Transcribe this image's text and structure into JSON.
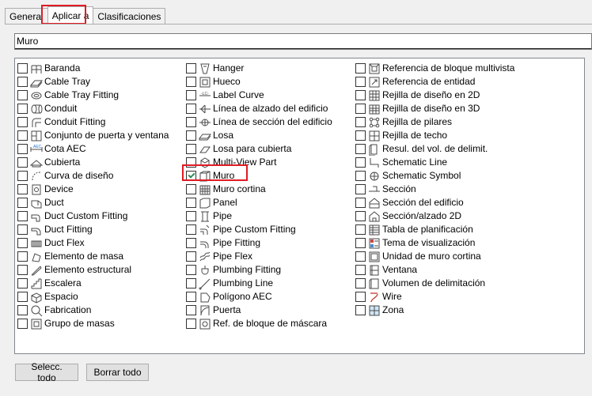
{
  "tabs": [
    {
      "label": "General"
    },
    {
      "label": "Aplicar a"
    },
    {
      "label": "Clasificaciones"
    }
  ],
  "name_input": {
    "value": "Muro"
  },
  "categories": {
    "col1": [
      {
        "label": "Baranda",
        "icon": "railing-icon",
        "checked": false
      },
      {
        "label": "Cable Tray",
        "icon": "cable-tray-icon",
        "checked": false
      },
      {
        "label": "Cable Tray Fitting",
        "icon": "cable-tray-fitting-icon",
        "checked": false
      },
      {
        "label": "Conduit",
        "icon": "conduit-icon",
        "checked": false
      },
      {
        "label": "Conduit Fitting",
        "icon": "conduit-fitting-icon",
        "checked": false
      },
      {
        "label": "Conjunto de puerta y ventana",
        "icon": "door-window-assembly-icon",
        "checked": false
      },
      {
        "label": "Cota AEC",
        "icon": "dimension-icon",
        "checked": false
      },
      {
        "label": "Cubierta",
        "icon": "roof-icon",
        "checked": false
      },
      {
        "label": "Curva de diseño",
        "icon": "layout-curve-icon",
        "checked": false
      },
      {
        "label": "Device",
        "icon": "device-icon",
        "checked": false
      },
      {
        "label": "Duct",
        "icon": "duct-icon",
        "checked": false
      },
      {
        "label": "Duct Custom Fitting",
        "icon": "duct-custom-fitting-icon",
        "checked": false
      },
      {
        "label": "Duct Fitting",
        "icon": "duct-fitting-icon",
        "checked": false
      },
      {
        "label": "Duct Flex",
        "icon": "duct-flex-icon",
        "checked": false
      },
      {
        "label": "Elemento de masa",
        "icon": "mass-element-icon",
        "checked": false
      },
      {
        "label": "Elemento estructural",
        "icon": "structural-member-icon",
        "checked": false
      },
      {
        "label": "Escalera",
        "icon": "stair-icon",
        "checked": false
      },
      {
        "label": "Espacio",
        "icon": "space-icon",
        "checked": false
      },
      {
        "label": "Fabrication",
        "icon": "fabrication-icon",
        "checked": false
      },
      {
        "label": "Grupo de masas",
        "icon": "mass-group-icon",
        "checked": false
      }
    ],
    "col2": [
      {
        "label": "Hanger",
        "icon": "hanger-icon",
        "checked": false
      },
      {
        "label": "Hueco",
        "icon": "opening-icon",
        "checked": false
      },
      {
        "label": "Label Curve",
        "icon": "label-curve-icon",
        "checked": false
      },
      {
        "label": "Línea de alzado del edificio",
        "icon": "elevation-line-icon",
        "checked": false
      },
      {
        "label": "Línea de sección del edificio",
        "icon": "section-line-icon",
        "checked": false
      },
      {
        "label": "Losa",
        "icon": "slab-icon",
        "checked": false
      },
      {
        "label": "Losa para cubierta",
        "icon": "roof-slab-icon",
        "checked": false
      },
      {
        "label": "Multi-View Part",
        "icon": "multi-view-part-icon",
        "checked": false
      },
      {
        "label": "Muro",
        "icon": "wall-icon",
        "checked": true
      },
      {
        "label": "Muro cortina",
        "icon": "curtain-wall-icon",
        "checked": false
      },
      {
        "label": "Panel",
        "icon": "panel-icon",
        "checked": false
      },
      {
        "label": "Pipe",
        "icon": "pipe-icon",
        "checked": false
      },
      {
        "label": "Pipe Custom Fitting",
        "icon": "pipe-custom-fitting-icon",
        "checked": false
      },
      {
        "label": "Pipe Fitting",
        "icon": "pipe-fitting-icon",
        "checked": false
      },
      {
        "label": "Pipe Flex",
        "icon": "pipe-flex-icon",
        "checked": false
      },
      {
        "label": "Plumbing Fitting",
        "icon": "plumbing-fitting-icon",
        "checked": false
      },
      {
        "label": "Plumbing Line",
        "icon": "plumbing-line-icon",
        "checked": false
      },
      {
        "label": "Polígono AEC",
        "icon": "polygon-icon",
        "checked": false
      },
      {
        "label": "Puerta",
        "icon": "door-icon",
        "checked": false
      },
      {
        "label": "Ref. de bloque de máscara",
        "icon": "mask-block-ref-icon",
        "checked": false
      }
    ],
    "col3": [
      {
        "label": "Referencia de bloque multivista",
        "icon": "multi-view-block-ref-icon",
        "checked": false
      },
      {
        "label": "Referencia de entidad",
        "icon": "entity-ref-icon",
        "checked": false
      },
      {
        "label": "Rejilla de diseño en 2D",
        "icon": "layout-grid-2d-icon",
        "checked": false
      },
      {
        "label": "Rejilla de diseño en 3D",
        "icon": "layout-grid-3d-icon",
        "checked": false
      },
      {
        "label": "Rejilla de pilares",
        "icon": "column-grid-icon",
        "checked": false
      },
      {
        "label": "Rejilla de techo",
        "icon": "ceiling-grid-icon",
        "checked": false
      },
      {
        "label": "Resul. del vol. de delimit.",
        "icon": "bounding-volume-result-icon",
        "checked": false
      },
      {
        "label": "Schematic Line",
        "icon": "schematic-line-icon",
        "checked": false
      },
      {
        "label": "Schematic Symbol",
        "icon": "schematic-symbol-icon",
        "checked": false
      },
      {
        "label": "Sección",
        "icon": "section-icon",
        "checked": false
      },
      {
        "label": "Sección del edificio",
        "icon": "building-section-icon",
        "checked": false
      },
      {
        "label": "Sección/alzado 2D",
        "icon": "section-elevation-2d-icon",
        "checked": false
      },
      {
        "label": "Tabla de planificación",
        "icon": "schedule-table-icon",
        "checked": false
      },
      {
        "label": "Tema de visualización",
        "icon": "display-theme-icon",
        "checked": false
      },
      {
        "label": "Unidad de muro cortina",
        "icon": "curtain-wall-unit-icon",
        "checked": false
      },
      {
        "label": "Ventana",
        "icon": "window-icon",
        "checked": false
      },
      {
        "label": "Volumen de delimitación",
        "icon": "bounding-volume-icon",
        "checked": false
      },
      {
        "label": "Wire",
        "icon": "wire-icon",
        "checked": false
      },
      {
        "label": "Zona",
        "icon": "zone-icon",
        "checked": false
      }
    ]
  },
  "buttons": {
    "select_all": "Selecc. todo",
    "clear_all": "Borrar todo"
  },
  "colors": {
    "highlight": "#e01b24",
    "check": "#2e8b57",
    "icon_stroke": "#4a4a4a"
  }
}
